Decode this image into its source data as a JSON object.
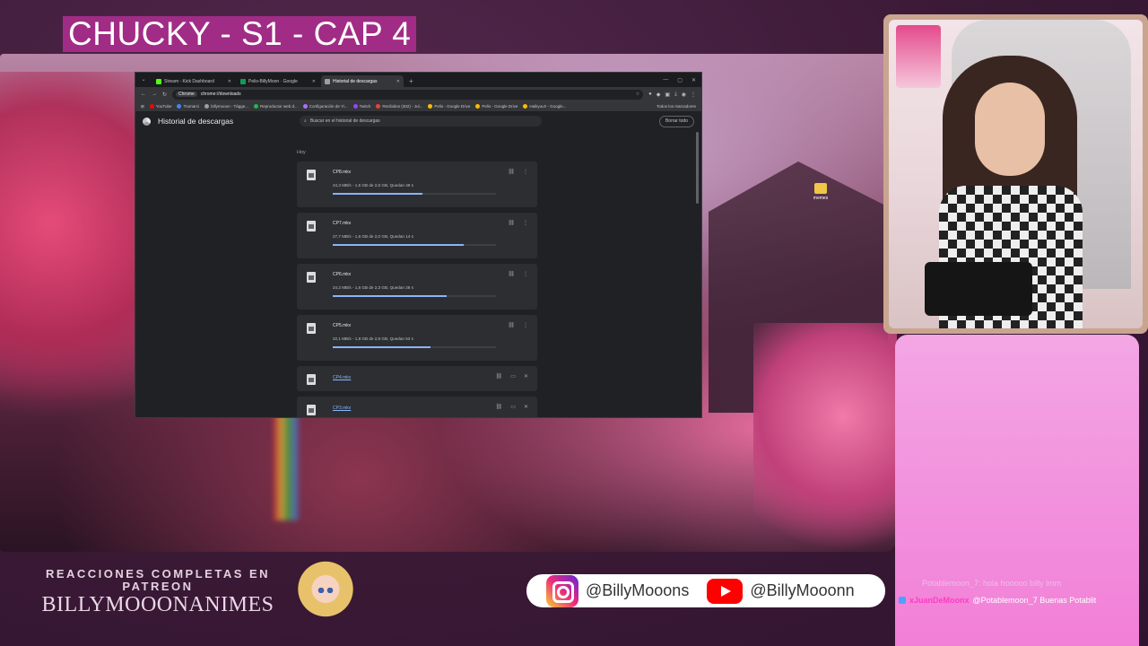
{
  "overlay": {
    "title": "CHUCKY - S1 - CAP 4",
    "promo_line1": "REACCIONES COMPLETAS EN PATREON",
    "promo_brand": "BILLYMOOONANIMES",
    "instagram": "@BillyMooons",
    "youtube": "@BillyMooonn",
    "desktop_folder": "memes"
  },
  "browser": {
    "tabs": [
      {
        "label": "Stream - Kick Dashboard",
        "color": "#53fc18"
      },
      {
        "label": "Pelis-BillyMoon · Google",
        "color": "#0f9d58"
      },
      {
        "label": "Historial de descargas",
        "color": "#9aa0a6"
      }
    ],
    "omnibox_chip": "Chrome",
    "url": "chrome://downloads",
    "bookmarks": [
      {
        "label": "YouTube",
        "color": "#ff0000"
      },
      {
        "label": "Trumarci",
        "color": "#4285f4"
      },
      {
        "label": "billymooon - Tágge...",
        "color": "#9aa0a6"
      },
      {
        "label": "Reproductor web d...",
        "color": "#1db954"
      },
      {
        "label": "Configuración de Yi...",
        "color": "#a970ff"
      },
      {
        "label": "Twitch",
        "color": "#9146ff"
      },
      {
        "label": "Recibidos (302) - Jul...",
        "color": "#ea4335"
      },
      {
        "label": "Pelis - Google Drive",
        "color": "#fbbc04"
      },
      {
        "label": "Pelis - Google Drive",
        "color": "#fbbc04"
      },
      {
        "label": "Haikyuu!! - Google...",
        "color": "#fbbc04"
      }
    ],
    "bookmarks_all": "Todos los marcadores"
  },
  "downloads_page": {
    "title": "Historial de descargas",
    "search_placeholder": "Buscar en el historial de descargas",
    "clear_all": "Borrar todo",
    "day_label": "Hoy",
    "items": [
      {
        "name": "CP8.mkv",
        "status": "24,3 MB/s - 1,5 GB de 2,6 GB, Quedan 49 s",
        "progress": 0.55,
        "state": "downloading"
      },
      {
        "name": "CP7.mkv",
        "status": "27,7 MB/s - 1,6 GB de 2,0 GB, Quedan 14 s",
        "progress": 0.8,
        "state": "downloading"
      },
      {
        "name": "CP6.mkv",
        "status": "24,2 MB/s - 1,6 GB de 2,3 GB, Quedan 28 s",
        "progress": 0.7,
        "state": "downloading"
      },
      {
        "name": "CP5.mkv",
        "status": "22,1 MB/s - 1,8 GB de 2,9 GB, Quedan 53 s",
        "progress": 0.6,
        "state": "downloading"
      },
      {
        "name": "CP4.mkv",
        "state": "complete"
      },
      {
        "name": "CP3.mkv",
        "state": "complete"
      }
    ]
  },
  "chat": {
    "line1": "Potablemoon_7: hola hooooo billy lmm",
    "line2_user": "xJuanDeMoonx",
    "line2_text": "@Potablemoon_7 Buenas Potablit"
  },
  "colors": {
    "accent_title_bg": "#a02c86",
    "chat_panel": "#f27fd7",
    "progress_fill": "#8ab4f8"
  }
}
